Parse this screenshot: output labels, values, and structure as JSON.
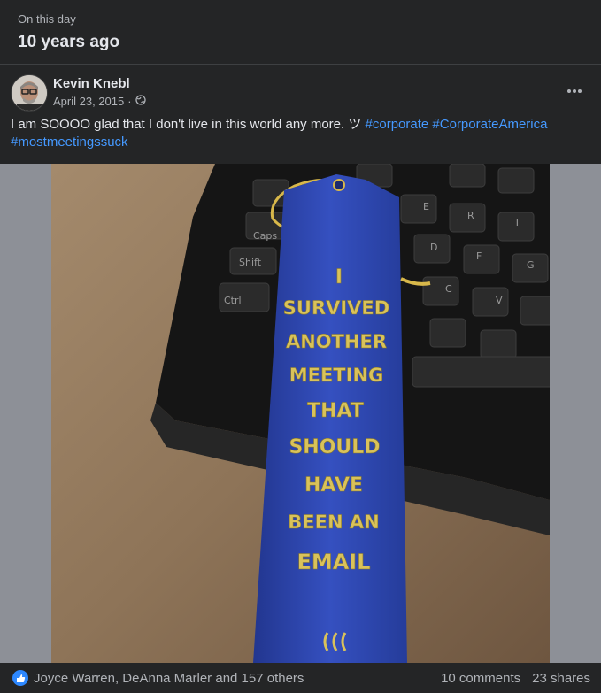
{
  "memory": {
    "eyebrow": "On this day",
    "title": "10 years ago"
  },
  "post": {
    "author": "Kevin Knebl",
    "date": "April 23, 2015",
    "separator": "·",
    "privacy_icon": "globe-icon",
    "more_icon": "more-options-icon",
    "text": "I am SOOOO glad that I don't live in this world any more. ツ ",
    "hashtags": [
      "#corporate",
      "#CorporateAmerica",
      "#mostmeetingssuck"
    ],
    "photo": {
      "description_ribbon_text": [
        "I",
        "SURVIVED",
        "ANOTHER",
        "MEETING",
        "THAT",
        "SHOULD",
        "HAVE",
        "BEEN AN",
        "EMAIL"
      ]
    }
  },
  "footer": {
    "reactions_icon": "like-icon",
    "reactions_text": "Joyce Warren, DeAnna Marler and 157 others",
    "comments": "10 comments",
    "shares": "23 shares"
  },
  "colors": {
    "background": "#242526",
    "text": "#e4e6eb",
    "secondary": "#b0b3b8",
    "hashtag": "#4599ff",
    "like_blue": "#2d88ff",
    "ribbon_blue": "#2c43a8",
    "ribbon_gold": "#d9c25a"
  }
}
